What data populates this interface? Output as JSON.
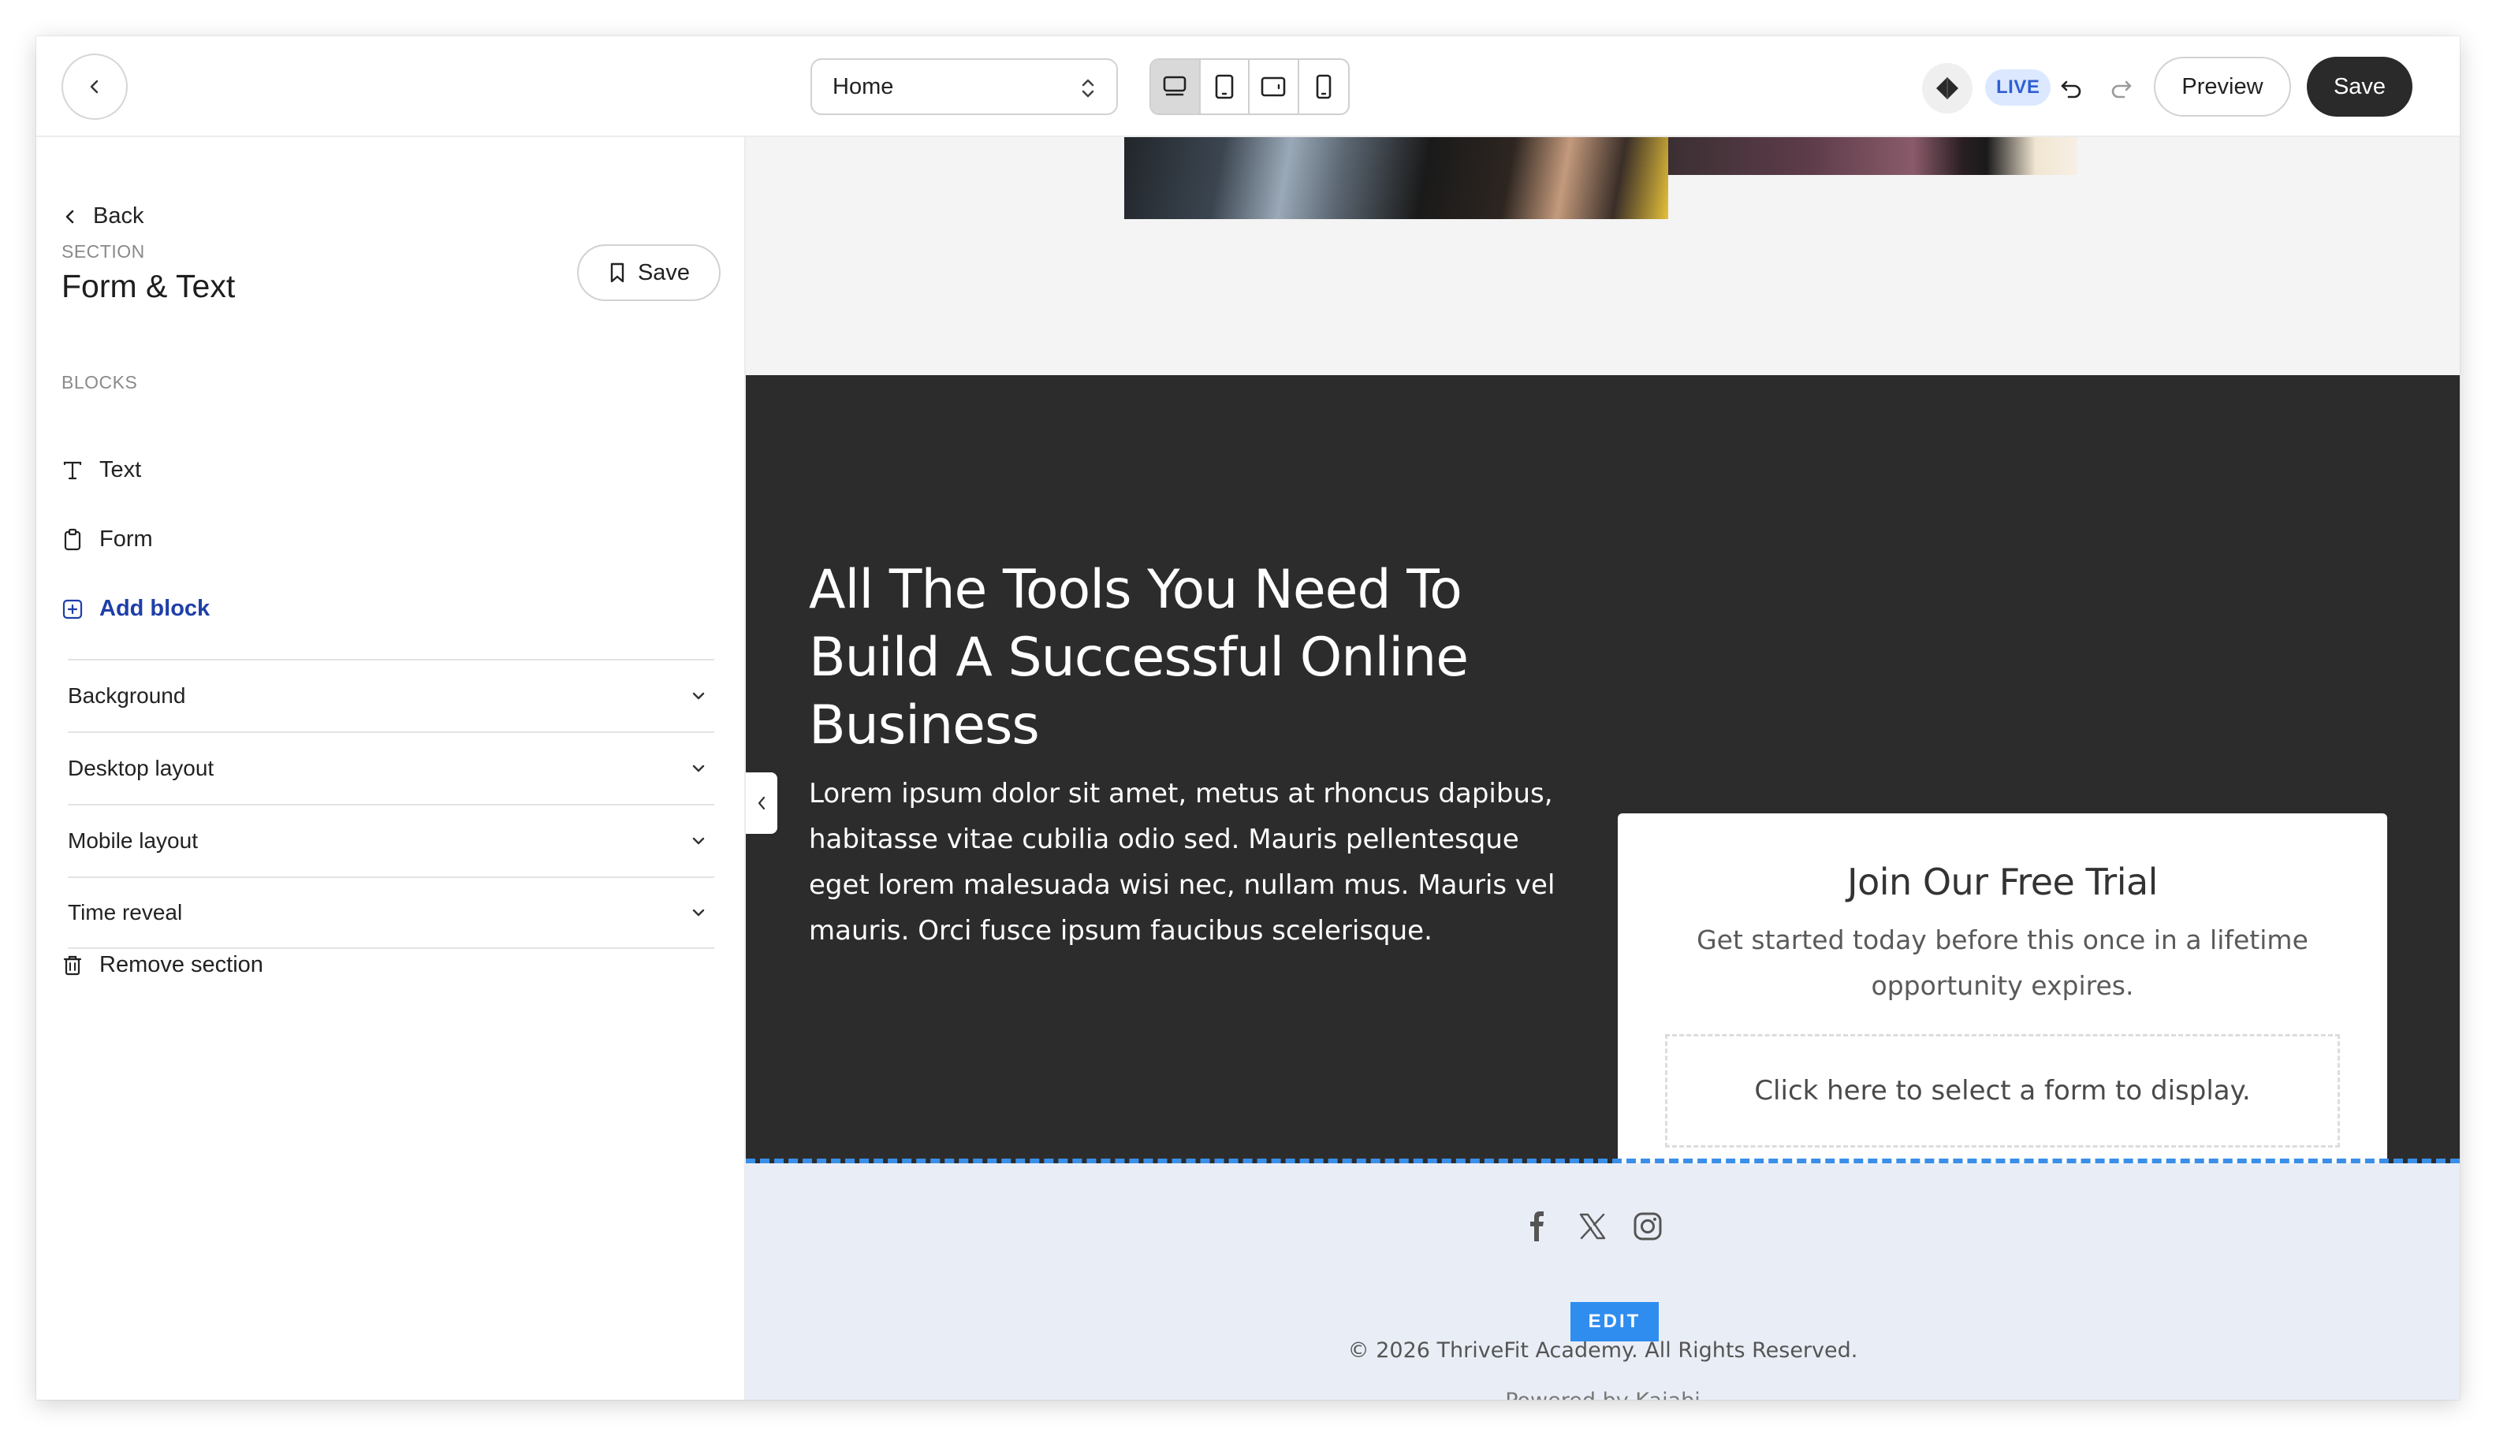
{
  "topbar": {
    "page_select": "Home",
    "live_badge": "LIVE",
    "preview_label": "Preview",
    "save_label": "Save"
  },
  "sidebar": {
    "back_label": "Back",
    "section_eyebrow": "SECTION",
    "section_title": "Form & Text",
    "section_save_label": "Save",
    "blocks_eyebrow": "BLOCKS",
    "blocks": [
      {
        "label": "Text",
        "icon": "text-icon"
      },
      {
        "label": "Form",
        "icon": "clipboard-icon"
      }
    ],
    "add_block_label": "Add block",
    "settings": [
      {
        "label": "Background"
      },
      {
        "label": "Desktop layout"
      },
      {
        "label": "Mobile layout"
      },
      {
        "label": "Time reveal"
      }
    ],
    "remove_label": "Remove section"
  },
  "canvas": {
    "headline": "All The Tools You Need To Build A Successful Online Business",
    "body": "Lorem ipsum dolor sit amet, metus at rhoncus dapibus, habitasse vitae cubilia odio sed. Mauris pellentesque eget lorem malesuada wisi nec, nullam mus. Mauris vel mauris. Orci fusce ipsum faucibus scelerisque.",
    "form_card": {
      "title": "Join Our Free Trial",
      "subtitle": "Get started today before this once in a lifetime opportunity expires.",
      "placeholder": "Click here to select a form to display."
    },
    "footer": {
      "edit_label": "EDIT",
      "copyright": "© 2026 ThriveFit Academy. All Rights Reserved.",
      "powered_by": "Powered by Kajabi"
    }
  },
  "colors": {
    "dark_section": "#2c2c2c",
    "accent_blue": "#2f8df0",
    "live_badge_bg": "#dbe8ff",
    "save_button_bg": "#2a2a2a"
  }
}
